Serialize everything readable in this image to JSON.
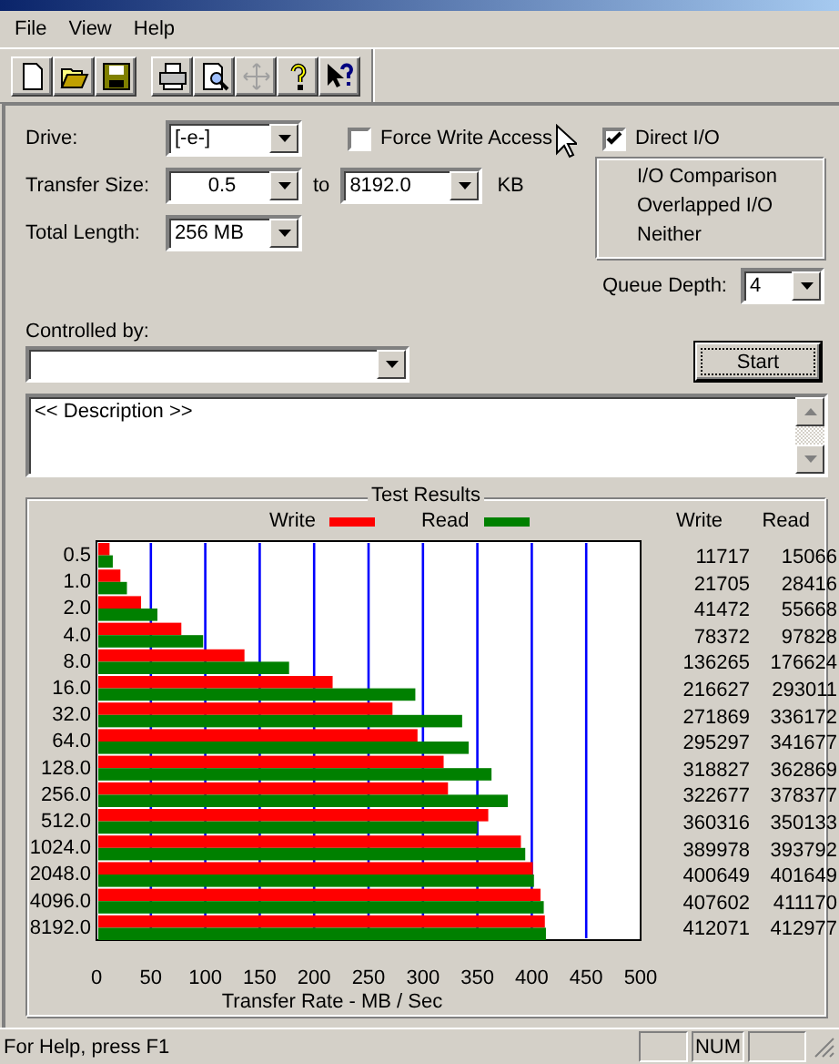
{
  "menu": [
    {
      "label": "File"
    },
    {
      "label": "View"
    },
    {
      "label": "Help"
    }
  ],
  "toolbar": [
    {
      "kind": "new",
      "disabled": false
    },
    {
      "kind": "open",
      "disabled": false
    },
    {
      "kind": "save",
      "disabled": false
    },
    {
      "kind": "print",
      "disabled": false
    },
    {
      "kind": "preview",
      "disabled": false
    },
    {
      "kind": "move",
      "disabled": true
    },
    {
      "kind": "help",
      "disabled": false
    },
    {
      "kind": "context-help",
      "disabled": false
    }
  ],
  "drive": {
    "label": "Drive:",
    "value": "[-e-]"
  },
  "force_write": {
    "label": "Force Write Access",
    "checked": false
  },
  "direct_io": {
    "label": "Direct I/O",
    "checked": true
  },
  "transfer_size": {
    "label": "Transfer Size:",
    "from": "0.5",
    "to_label": "to",
    "to": "8192.0",
    "unit": "KB"
  },
  "total_length": {
    "label": "Total Length:",
    "value": "256 MB"
  },
  "io_modes": [
    {
      "label": "I/O Comparison"
    },
    {
      "label": "Overlapped I/O"
    },
    {
      "label": "Neither"
    }
  ],
  "queue_depth": {
    "label": "Queue Depth:",
    "value": "4"
  },
  "controlled_by": {
    "label": "Controlled by:"
  },
  "start_button": {
    "label": "Start"
  },
  "description": "<< Description >>",
  "test_results": {
    "title": "Test Results",
    "chart_data": {
      "type": "bar",
      "orientation": "horizontal",
      "grid": true,
      "xlabel": "Transfer Rate - MB / Sec",
      "categories": [
        "0.5",
        "1.0",
        "2.0",
        "4.0",
        "8.0",
        "16.0",
        "32.0",
        "64.0",
        "128.0",
        "256.0",
        "512.0",
        "1024.0",
        "2048.0",
        "4096.0",
        "8192.0"
      ],
      "series": [
        {
          "name": "Write",
          "color": "#ff0000",
          "values": [
            12,
            22,
            41,
            78,
            136,
            217,
            272,
            295,
            319,
            323,
            360,
            390,
            401,
            408,
            412
          ]
        },
        {
          "name": "Read",
          "color": "#008000",
          "values": [
            15,
            28,
            56,
            98,
            177,
            293,
            336,
            342,
            363,
            378,
            350,
            394,
            402,
            411,
            413
          ]
        }
      ],
      "xlim": [
        0,
        500
      ],
      "xticks": [
        0,
        50,
        100,
        150,
        200,
        250,
        300,
        350,
        400,
        450,
        500
      ]
    },
    "columns": [
      "Write",
      "Read"
    ],
    "rows": [
      [
        "11717",
        "15066"
      ],
      [
        "21705",
        "28416"
      ],
      [
        "41472",
        "55668"
      ],
      [
        "78372",
        "97828"
      ],
      [
        "136265",
        "176624"
      ],
      [
        "216627",
        "293011"
      ],
      [
        "271869",
        "336172"
      ],
      [
        "295297",
        "341677"
      ],
      [
        "318827",
        "362869"
      ],
      [
        "322677",
        "378377"
      ],
      [
        "360316",
        "350133"
      ],
      [
        "389978",
        "393792"
      ],
      [
        "400649",
        "401649"
      ],
      [
        "407602",
        "411170"
      ],
      [
        "412071",
        "412977"
      ]
    ]
  },
  "status_bar": {
    "text": "For Help, press F1",
    "indicators": [
      "NUM"
    ]
  }
}
